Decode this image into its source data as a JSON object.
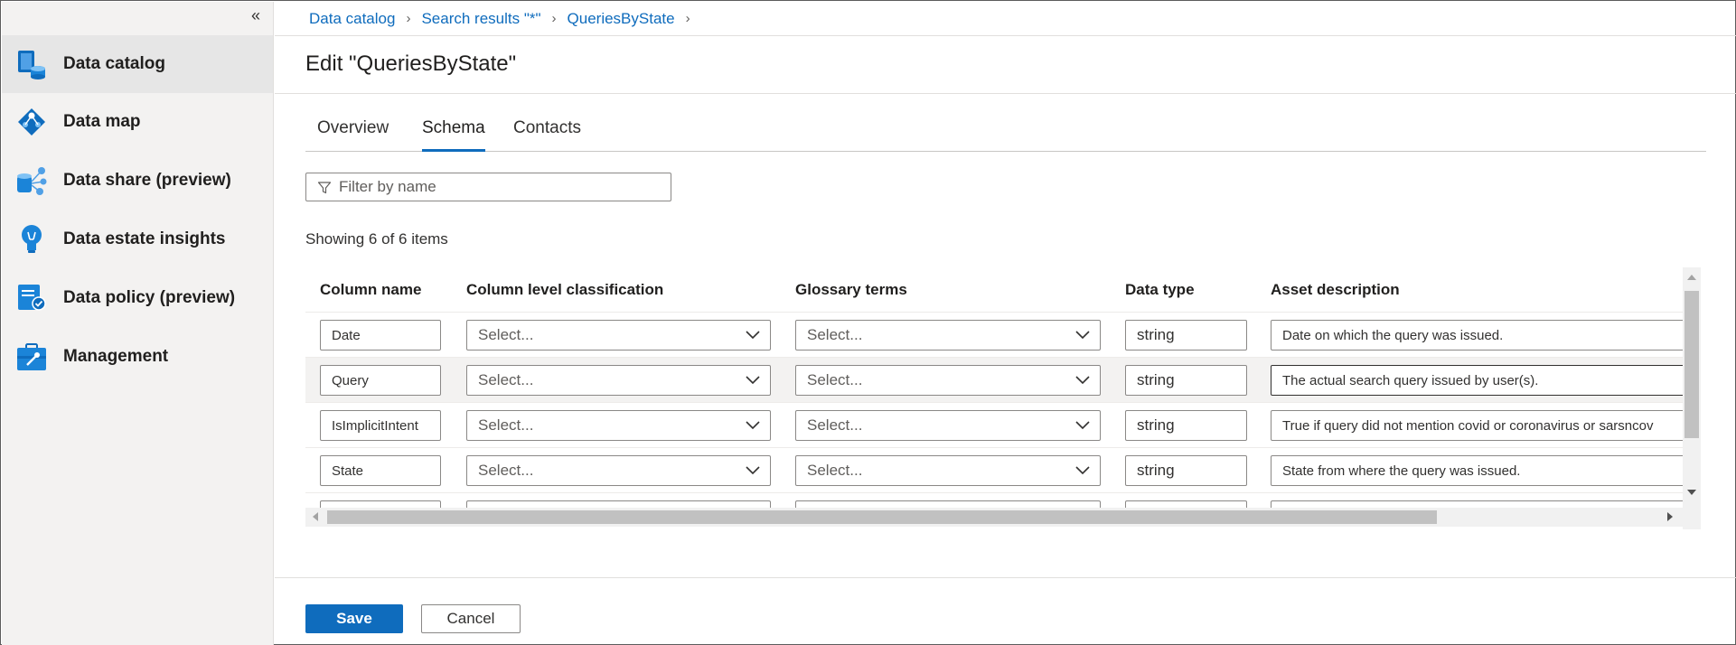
{
  "sidebar": {
    "collapse_glyph": "«",
    "items": [
      {
        "label": "Data catalog",
        "icon": "data-catalog-icon",
        "active": true
      },
      {
        "label": "Data map",
        "icon": "data-map-icon",
        "active": false
      },
      {
        "label": "Data share (preview)",
        "icon": "data-share-icon",
        "active": false
      },
      {
        "label": "Data estate insights",
        "icon": "insights-icon",
        "active": false
      },
      {
        "label": "Data policy (preview)",
        "icon": "policy-icon",
        "active": false
      },
      {
        "label": "Management",
        "icon": "management-icon",
        "active": false
      }
    ]
  },
  "breadcrumb": [
    "Data catalog",
    "Search results \"*\"",
    "QueriesByState"
  ],
  "page_title": "Edit \"QueriesByState\"",
  "tabs": [
    {
      "label": "Overview",
      "active": false
    },
    {
      "label": "Schema",
      "active": true
    },
    {
      "label": "Contacts",
      "active": false
    }
  ],
  "filter": {
    "placeholder": "Filter by name",
    "value": ""
  },
  "count_text": "Showing 6 of 6 items",
  "table": {
    "headers": [
      "Column name",
      "Column level classification",
      "Glossary terms",
      "Data type",
      "Asset description"
    ],
    "select_placeholder": "Select...",
    "rows": [
      {
        "name": "Date",
        "classification": "Select...",
        "glossary": "Select...",
        "type": "string",
        "description": "Date on which the query was issued."
      },
      {
        "name": "Query",
        "classification": "Select...",
        "glossary": "Select...",
        "type": "string",
        "description": "The actual search query issued by user(s)."
      },
      {
        "name": "IsImplicitIntent",
        "classification": "Select...",
        "glossary": "Select...",
        "type": "string",
        "description": "True if query did not mention covid or coronavirus or sarsncov"
      },
      {
        "name": "State",
        "classification": "Select...",
        "glossary": "Select...",
        "type": "string",
        "description": "State from where the query was issued."
      }
    ]
  },
  "buttons": {
    "save": "Save",
    "cancel": "Cancel"
  },
  "colors": {
    "accent": "#0f6cbd",
    "sidebar_bg": "#f3f2f1",
    "active_item_bg": "#e6e6e6"
  }
}
